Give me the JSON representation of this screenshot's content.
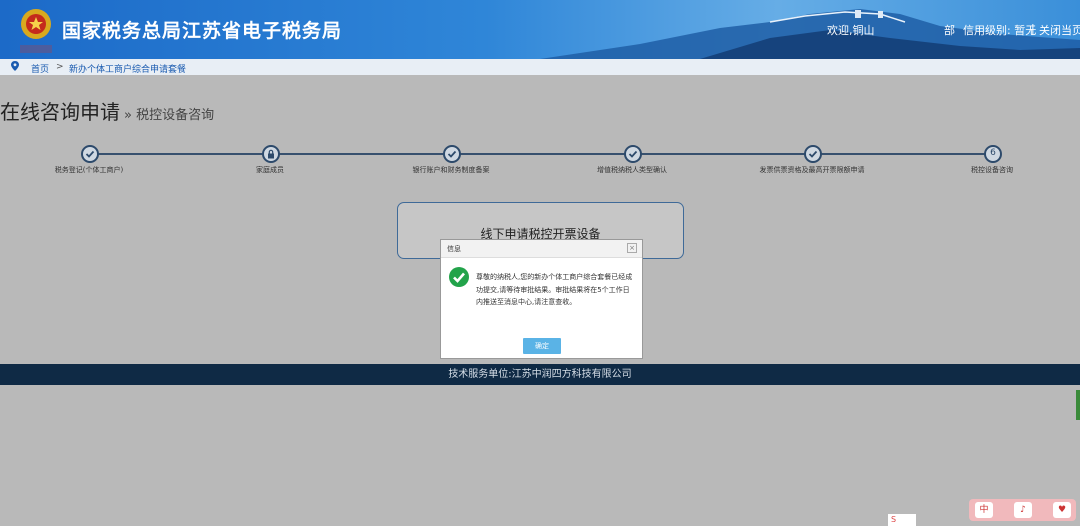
{
  "header": {
    "title": "国家税务总局江苏省电子税务局",
    "emblem_text": "中国税务",
    "welcome": "欢迎,铜山",
    "suffix_fragment": "部",
    "credit": "信用级别: 暂无",
    "separator": "|",
    "close": "关闭当页"
  },
  "breadcrumb": {
    "home": "首页",
    "separator": ">",
    "current": "新办个体工商户综合申请套餐"
  },
  "page": {
    "title": "在线咨询申请",
    "subtitle": "» 税控设备咨询"
  },
  "steps": [
    {
      "label": "税务登记(个体工商户)",
      "status": "done",
      "icon": "check-icon"
    },
    {
      "label": "家庭成员",
      "status": "locked",
      "icon": "lock-icon"
    },
    {
      "label": "银行账户和财务制度备案",
      "status": "done",
      "icon": "check-icon"
    },
    {
      "label": "增值税纳税人类型确认",
      "status": "done",
      "icon": "check-icon"
    },
    {
      "label": "发票供票资格及最高开票限额申请",
      "status": "done",
      "icon": "check-icon"
    },
    {
      "label": "税控设备咨询",
      "status": "current",
      "number": "6"
    }
  ],
  "offline_button": {
    "label": "线下申请税控开票设备"
  },
  "footer": {
    "text": "技术服务单位:江苏中润四方科技有限公司"
  },
  "dialog": {
    "title": "信息",
    "close": "×",
    "message": "尊敬的纳税人,您的新办个体工商户综合套餐已经成功提交,请等待审批结果。审批结果将在5个工作日内推送至消息中心,请注意查收。",
    "ok_label": "确定"
  },
  "corner_widget": {
    "items": [
      "中",
      "♪",
      "♥"
    ]
  },
  "ime_indicator": {
    "label": "S"
  },
  "colors": {
    "header_blue": "#2f86d8",
    "footer_navy": "#0f2a45",
    "success_green": "#22a34a",
    "ok_button": "#5ab3e6",
    "link_blue": "#1a5bb0"
  }
}
